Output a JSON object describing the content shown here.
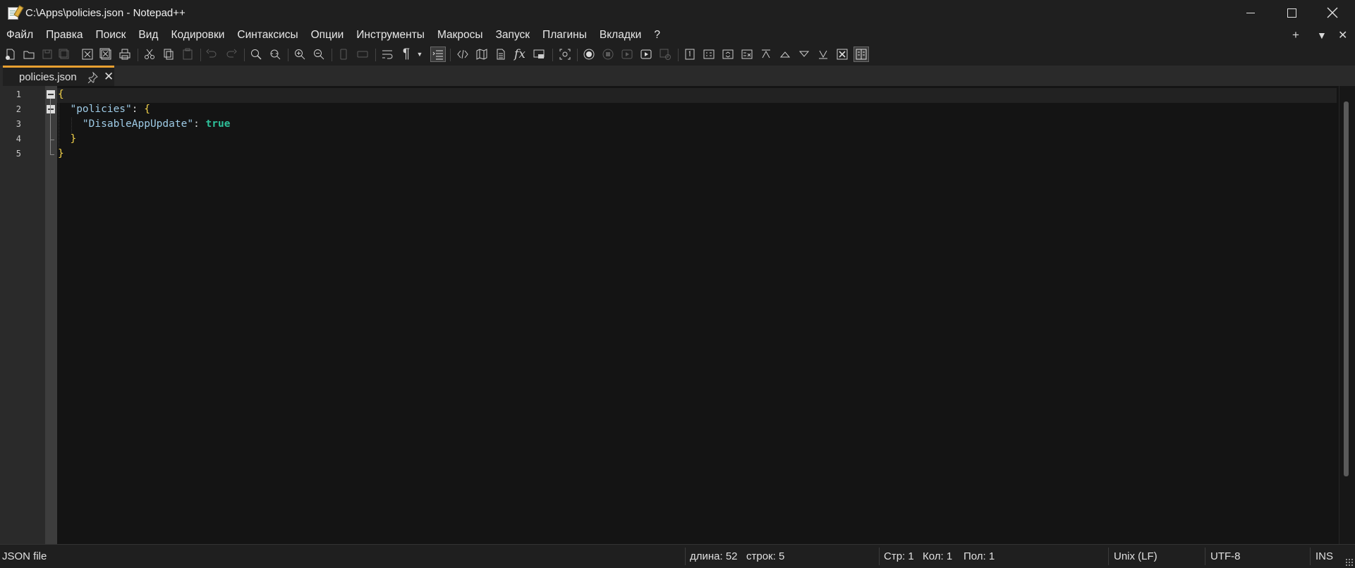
{
  "window": {
    "title": "C:\\Apps\\policies.json - Notepad++"
  },
  "menu": {
    "items": [
      "Файл",
      "Правка",
      "Поиск",
      "Вид",
      "Кодировки",
      "Синтаксисы",
      "Опции",
      "Инструменты",
      "Макросы",
      "Запуск",
      "Плагины",
      "Вкладки",
      "?"
    ],
    "right_controls": [
      "+",
      "▼",
      "✕"
    ]
  },
  "toolbar": {
    "buttons": [
      "new-file",
      "open-file",
      "save",
      "save-all",
      "close",
      "close-all",
      "print",
      "cut",
      "copy",
      "paste",
      "undo",
      "redo",
      "find",
      "replace",
      "zoom-in",
      "zoom-out",
      "sync-vertical",
      "sync-horizontal",
      "word-wrap",
      "show-all-characters",
      "indent-guide",
      "user-defined-language",
      "document-map",
      "document-list",
      "function-list",
      "folder-as-workspace",
      "monitoring",
      "record-macro",
      "stop-recording",
      "playback-macro",
      "run-macro-multiple",
      "save-macro",
      "plugin-1",
      "plugin-2",
      "plugin-3",
      "plugin-4",
      "plugin-5",
      "plugin-6",
      "plugin-7",
      "plugin-8",
      "plugin-9",
      "plugin-10"
    ]
  },
  "tabs": [
    {
      "label": "policies.json",
      "active": true
    }
  ],
  "editor": {
    "line_numbers": [
      "1",
      "2",
      "3",
      "4",
      "5"
    ],
    "lines": [
      {
        "indent": "",
        "parts": [
          {
            "t": "{",
            "c": "brace"
          }
        ]
      },
      {
        "indent": "  ",
        "parts": [
          {
            "t": "\"policies\"",
            "c": "str"
          },
          {
            "t": ": ",
            "c": "punct"
          },
          {
            "t": "{",
            "c": "brace"
          }
        ]
      },
      {
        "indent": "    ",
        "parts": [
          {
            "t": "\"DisableAppUpdate\"",
            "c": "str"
          },
          {
            "t": ": ",
            "c": "punct"
          },
          {
            "t": "true",
            "c": "kw"
          }
        ]
      },
      {
        "indent": "  ",
        "parts": [
          {
            "t": "}",
            "c": "brace"
          }
        ]
      },
      {
        "indent": "",
        "parts": [
          {
            "t": "}",
            "c": "brace"
          }
        ]
      }
    ]
  },
  "status": {
    "file_type": "JSON file",
    "length": "длина: 52",
    "lines": "строк: 5",
    "line_pos": "Стр: 1",
    "col_pos": "Кол: 1",
    "sel_pos": "Пол: 1",
    "eol": "Unix (LF)",
    "encoding": "UTF-8",
    "mode": "INS"
  },
  "colors": {
    "tab_accent": "#e8a030",
    "brace": "#f2d24a",
    "string": "#9ecbe6",
    "keyword": "#2ec09a"
  }
}
